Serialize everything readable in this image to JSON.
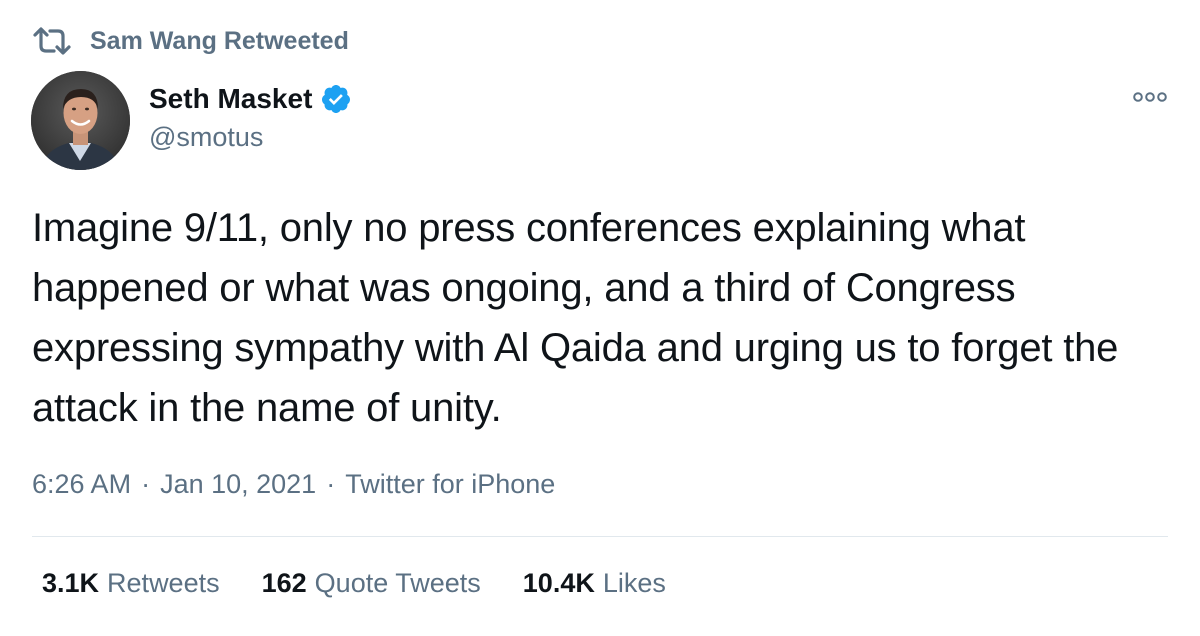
{
  "retweet_context": {
    "label": "Sam Wang Retweeted",
    "icon": "retweet-icon"
  },
  "author": {
    "name": "Seth Masket",
    "handle": "@smotus",
    "verified": true,
    "verified_icon": "verified-badge-icon",
    "verified_color": "#1da1f2"
  },
  "more_icon": "more-options-icon",
  "tweet": {
    "text": "Imagine 9/11, only no press conferences explaining what happened or what was ongoing, and a third of Congress expressing sympathy with Al Qaida and urging us to forget the attack in the name of unity."
  },
  "meta": {
    "time": "6:26 AM",
    "separator": "·",
    "date": "Jan 10, 2021",
    "source": "Twitter for iPhone"
  },
  "stats": {
    "retweets_count": "3.1K",
    "retweets_label": "Retweets",
    "quotes_count": "162",
    "quotes_label": "Quote Tweets",
    "likes_count": "10.4K",
    "likes_label": "Likes"
  },
  "colors": {
    "text_primary": "#0f1419",
    "text_secondary": "#5b7083",
    "divider": "#e1e8ed",
    "accent": "#1da1f2"
  }
}
